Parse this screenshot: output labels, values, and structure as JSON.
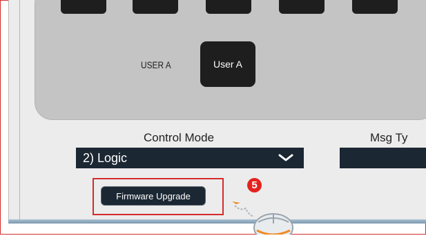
{
  "top_buttons": [
    "",
    "",
    "",
    "",
    ""
  ],
  "user_section": {
    "label": "USER A",
    "button_label": "User A"
  },
  "control_mode": {
    "label": "Control Mode",
    "selected_value": "2) Logic"
  },
  "msg_type": {
    "label": "Msg Ty"
  },
  "firmware": {
    "button_label": "Firmware Upgrade"
  },
  "annotation": {
    "step_number": "5",
    "highlight_color": "#d42a2a",
    "badge_color": "#e3231f"
  },
  "icons": [
    "chevron-down-icon",
    "mouse-icon",
    "pointer-arrow-icon"
  ],
  "colors": {
    "dark_control": "#1b2733",
    "panel_gray": "#c4c4c4",
    "button_black": "#1e1e1e"
  }
}
